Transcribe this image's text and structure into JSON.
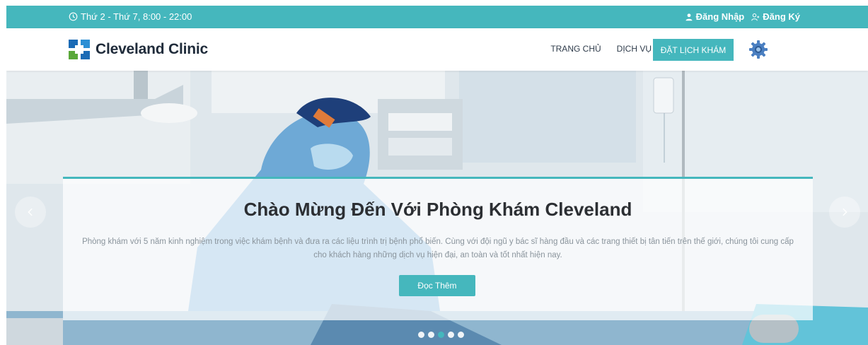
{
  "topbar": {
    "hours": "Thứ 2 - Thứ 7, 8:00 - 22:00",
    "login": "Đăng Nhập",
    "register": "Đăng Ký"
  },
  "navbar": {
    "brand": "Cleveland Clinic",
    "links": [
      "TRANG CHỦ",
      "DỊCH VỤ"
    ],
    "book_button": "ĐẶT LỊCH KHÁM"
  },
  "hero": {
    "title": "Chào Mừng Đến Với Phòng Khám Cleveland",
    "description": "Phòng khám với 5 năm kinh nghiệm trong việc khám bệnh và đưa ra các liệu trình trị bệnh phổ biến. Cùng với đội ngũ y bác sĩ hàng đầu và các trang thiết bị tân tiến trên thế giới, chúng tôi cung cấp cho khách hàng những dịch vụ hiện đại, an toàn và tốt nhất hiện nay.",
    "read_more": "Đọc Thêm",
    "slide_count": 5,
    "active_slide": 3
  },
  "colors": {
    "accent": "#45b7bd",
    "brand_text": "#1f2b3a"
  },
  "icons": {
    "hours": "clock-icon",
    "login": "user-icon",
    "register": "user-plus-icon",
    "settings": "gear-icon",
    "prev": "chevron-left-icon",
    "next": "chevron-right-icon"
  }
}
